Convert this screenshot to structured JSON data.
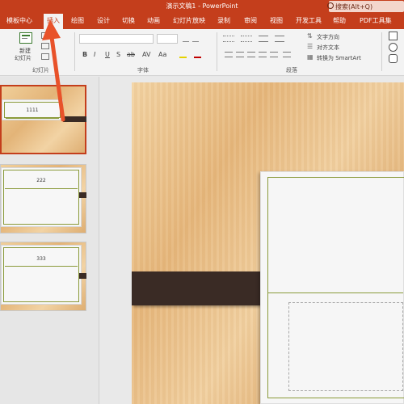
{
  "window": {
    "title": "演示文稿1  -  PowerPoint",
    "search_placeholder": "搜索(Alt+Q)"
  },
  "tabs": [
    {
      "label": "模板中心"
    },
    {
      "label": "插入"
    },
    {
      "label": "绘图"
    },
    {
      "label": "设计"
    },
    {
      "label": "切换"
    },
    {
      "label": "动画"
    },
    {
      "label": "幻灯片放映"
    },
    {
      "label": "录制"
    },
    {
      "label": "审阅"
    },
    {
      "label": "视图"
    },
    {
      "label": "开发工具"
    },
    {
      "label": "帮助"
    },
    {
      "label": "PDF工具集"
    }
  ],
  "ribbon": {
    "new_slide_line1": "新建",
    "new_slide_line2": "幻灯片",
    "group_slides": "幻灯片",
    "group_font": "字体",
    "group_paragraph": "段落",
    "format_buttons": [
      "B",
      "I",
      "U",
      "S",
      "ab",
      "AV",
      "Aa"
    ],
    "text_direction": "文字方向",
    "align_text": "对齐文本",
    "smartart": "转换为 SmartArt"
  },
  "thumbnails": [
    {
      "number": "1111",
      "selected": true
    },
    {
      "number": "222",
      "selected": false
    },
    {
      "number": "333",
      "selected": false
    }
  ],
  "colors": {
    "accent": "#c43e1c",
    "card_border": "#8a9a3a",
    "band": "#3a2b25",
    "arrow": "#e8522a"
  },
  "icons": [
    "search-icon",
    "new-slide-icon",
    "layout-icon",
    "shapes-icon",
    "text-direction-icon",
    "align-text-icon",
    "smartart-icon"
  ]
}
